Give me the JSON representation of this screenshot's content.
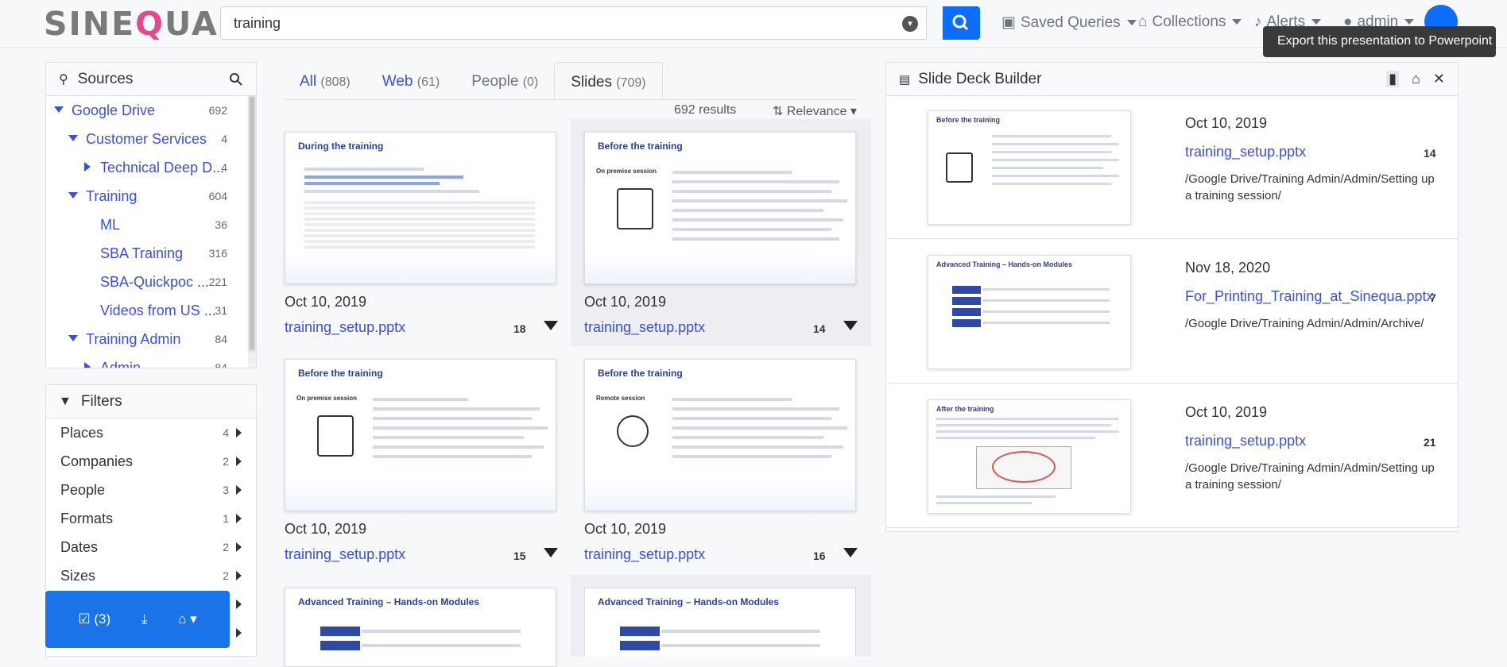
{
  "header": {
    "logo": "SINEQUA",
    "search_value": "training",
    "nav": [
      {
        "label": "Saved Queries",
        "icon": "floppy-icon"
      },
      {
        "label": "Collections",
        "icon": "inbox-icon"
      },
      {
        "label": "Alerts",
        "icon": "bell-icon"
      },
      {
        "label": "admin",
        "icon": "user-icon"
      }
    ],
    "tooltip": "Export this presentation to Powerpoint"
  },
  "sources": {
    "title": "Sources",
    "items": [
      {
        "label": "Google Drive",
        "count": "692"
      },
      {
        "label": "Customer Services",
        "count": "4"
      },
      {
        "label": "Technical Deep D...",
        "count": "4"
      },
      {
        "label": "Training",
        "count": "604"
      },
      {
        "label": "ML",
        "count": "36"
      },
      {
        "label": "SBA Training",
        "count": "316"
      },
      {
        "label": "SBA-Quickpoc ...",
        "count": "221"
      },
      {
        "label": "Videos from US ...",
        "count": "31"
      },
      {
        "label": "Training Admin",
        "count": "84"
      },
      {
        "label": "Admin",
        "count": "84"
      }
    ]
  },
  "filters": {
    "title": "Filters",
    "items": [
      {
        "label": "Places",
        "count": "4"
      },
      {
        "label": "Companies",
        "count": "2"
      },
      {
        "label": "People",
        "count": "3"
      },
      {
        "label": "Formats",
        "count": "1"
      },
      {
        "label": "Dates",
        "count": "2"
      },
      {
        "label": "Sizes",
        "count": "2"
      }
    ]
  },
  "basket": {
    "selected": "(3)"
  },
  "tabs": [
    {
      "label": "All",
      "count": "(808)"
    },
    {
      "label": "Web",
      "count": "(61)"
    },
    {
      "label": "People",
      "count": "(0)"
    },
    {
      "label": "Slides",
      "count": "(709)"
    }
  ],
  "results": {
    "count": "692 results",
    "sort": "Relevance",
    "cards": [
      {
        "slide_title": "During the training",
        "date": "Oct 10, 2019",
        "file": "training_setup.pptx",
        "page": "18"
      },
      {
        "slide_title": "Before the training",
        "date": "Oct 10, 2019",
        "file": "training_setup.pptx",
        "page": "14"
      },
      {
        "slide_title": "Before the training",
        "date": "Oct 10, 2019",
        "file": "training_setup.pptx",
        "page": "15"
      },
      {
        "slide_title": "Before the training",
        "date": "Oct 10, 2019",
        "file": "training_setup.pptx",
        "page": "16"
      },
      {
        "slide_title": "Advanced Training – Hands-on Modules"
      },
      {
        "slide_title": "Advanced Training – Hands-on Modules"
      }
    ]
  },
  "builder": {
    "title": "Slide Deck Builder",
    "items": [
      {
        "slide_title": "Before the training",
        "date": "Oct 10, 2019",
        "file": "training_setup.pptx",
        "page": "14",
        "path": "/Google Drive/Training Admin/Admin/Setting up a training session/"
      },
      {
        "slide_title": "Advanced Training – Hands-on Modules",
        "date": "Nov 18, 2020",
        "file": "For_Printing_Training_at_Sinequa.pptx",
        "page": "7",
        "path": "/Google Drive/Training Admin/Admin/Archive/"
      },
      {
        "slide_title": "After the training",
        "date": "Oct 10, 2019",
        "file": "training_setup.pptx",
        "page": "21",
        "path": "/Google Drive/Training Admin/Admin/Setting up a training session/"
      }
    ]
  },
  "colors": {
    "accent": "#0d6efd",
    "link": "#3b50d6"
  }
}
